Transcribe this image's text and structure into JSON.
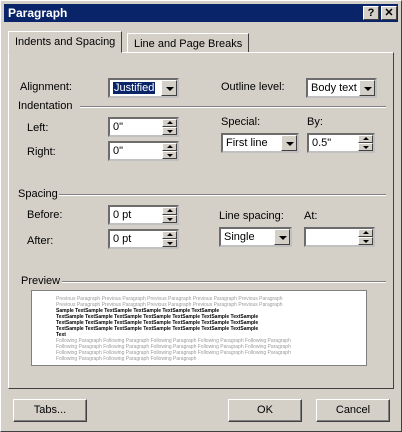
{
  "window": {
    "title": "Paragraph",
    "help_button": "?",
    "close_button": "✕"
  },
  "tabs": [
    {
      "label": "Indents and Spacing",
      "active": true
    },
    {
      "label": "Line and Page Breaks",
      "active": false
    }
  ],
  "general": {
    "alignment_label": "Alignment:",
    "alignment_value": "Justified",
    "outline_label": "Outline level:",
    "outline_value": "Body text"
  },
  "indentation": {
    "group_label": "Indentation",
    "left_label": "Left:",
    "left_value": "0\"",
    "right_label": "Right:",
    "right_value": "0\"",
    "special_label": "Special:",
    "special_value": "First line",
    "by_label": "By:",
    "by_value": "0.5\""
  },
  "spacing": {
    "group_label": "Spacing",
    "before_label": "Before:",
    "before_value": "0 pt",
    "after_label": "After:",
    "after_value": "0 pt",
    "line_spacing_label": "Line spacing:",
    "line_spacing_value": "Single",
    "at_label": "At:",
    "at_value": ""
  },
  "preview": {
    "group_label": "Preview",
    "lines": [
      {
        "style": "prev",
        "text": "Previous Paragraph Previous Paragraph Previous Paragraph Previous Paragraph Previous Paragraph"
      },
      {
        "style": "prev",
        "text": "Previous Paragraph Previous Paragraph Previous Paragraph Previous Paragraph Previous Paragraph"
      },
      {
        "style": "sample",
        "text": "          Sample    TextSample    TextSample    TextSample    TextSample    TextSample"
      },
      {
        "style": "sample",
        "text": "TextSample  TextSample  TextSample  TextSample  TextSample  TextSample  TextSample"
      },
      {
        "style": "sample",
        "text": "TextSample  TextSample  TextSample  TextSample  TextSample  TextSample  TextSample"
      },
      {
        "style": "sample",
        "text": "TextSample  TextSample  TextSample  TextSample  TextSample  TextSample  TextSample"
      },
      {
        "style": "sample",
        "text": "Text"
      },
      {
        "style": "prev",
        "text": "Following Paragraph Following Paragraph Following Paragraph Following Paragraph Following Paragraph"
      },
      {
        "style": "prev",
        "text": "Following Paragraph Following Paragraph Following Paragraph Following Paragraph Following Paragraph"
      },
      {
        "style": "prev",
        "text": "Following Paragraph Following Paragraph Following Paragraph Following Paragraph Following Paragraph"
      },
      {
        "style": "prev",
        "text": "Following Paragraph Following Paragraph Following Paragraph"
      }
    ]
  },
  "buttons": {
    "tabs": "Tabs...",
    "ok": "OK",
    "cancel": "Cancel"
  }
}
